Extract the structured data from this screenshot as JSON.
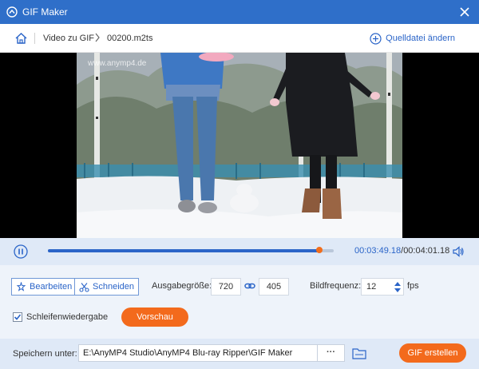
{
  "window": {
    "title": "GIF Maker"
  },
  "breadcrumb": {
    "section": "Video zu GIF",
    "file": "00200.m2ts"
  },
  "source": {
    "change_label": "Quelldatei ändern"
  },
  "video": {
    "watermark": "www.anymp4.de"
  },
  "playback": {
    "current": "00:03:49.18",
    "separator": "/",
    "total": "00:04:01.18",
    "progress_fraction": 0.95
  },
  "tools": {
    "edit_label": "Bearbeiten",
    "cut_label": "Schneiden"
  },
  "output": {
    "size_label": "Ausgabegröße:",
    "width": "720",
    "height": "405",
    "framerate_label": "Bildfrequenz:",
    "framerate": "12",
    "fps_unit": "fps",
    "loop_label": "Schleifenwiedergabe",
    "loop_checked": true,
    "preview_label": "Vorschau"
  },
  "save": {
    "label": "Speichern unter:",
    "path": "E:\\AnyMP4 Studio\\AnyMP4 Blu-ray Ripper\\GIF Maker",
    "browse_label": "···",
    "create_label": "GIF erstellen"
  },
  "colors": {
    "accent_blue": "#2f6fc9",
    "orange": "#f36a1c",
    "panel": "#dfe9f7"
  }
}
